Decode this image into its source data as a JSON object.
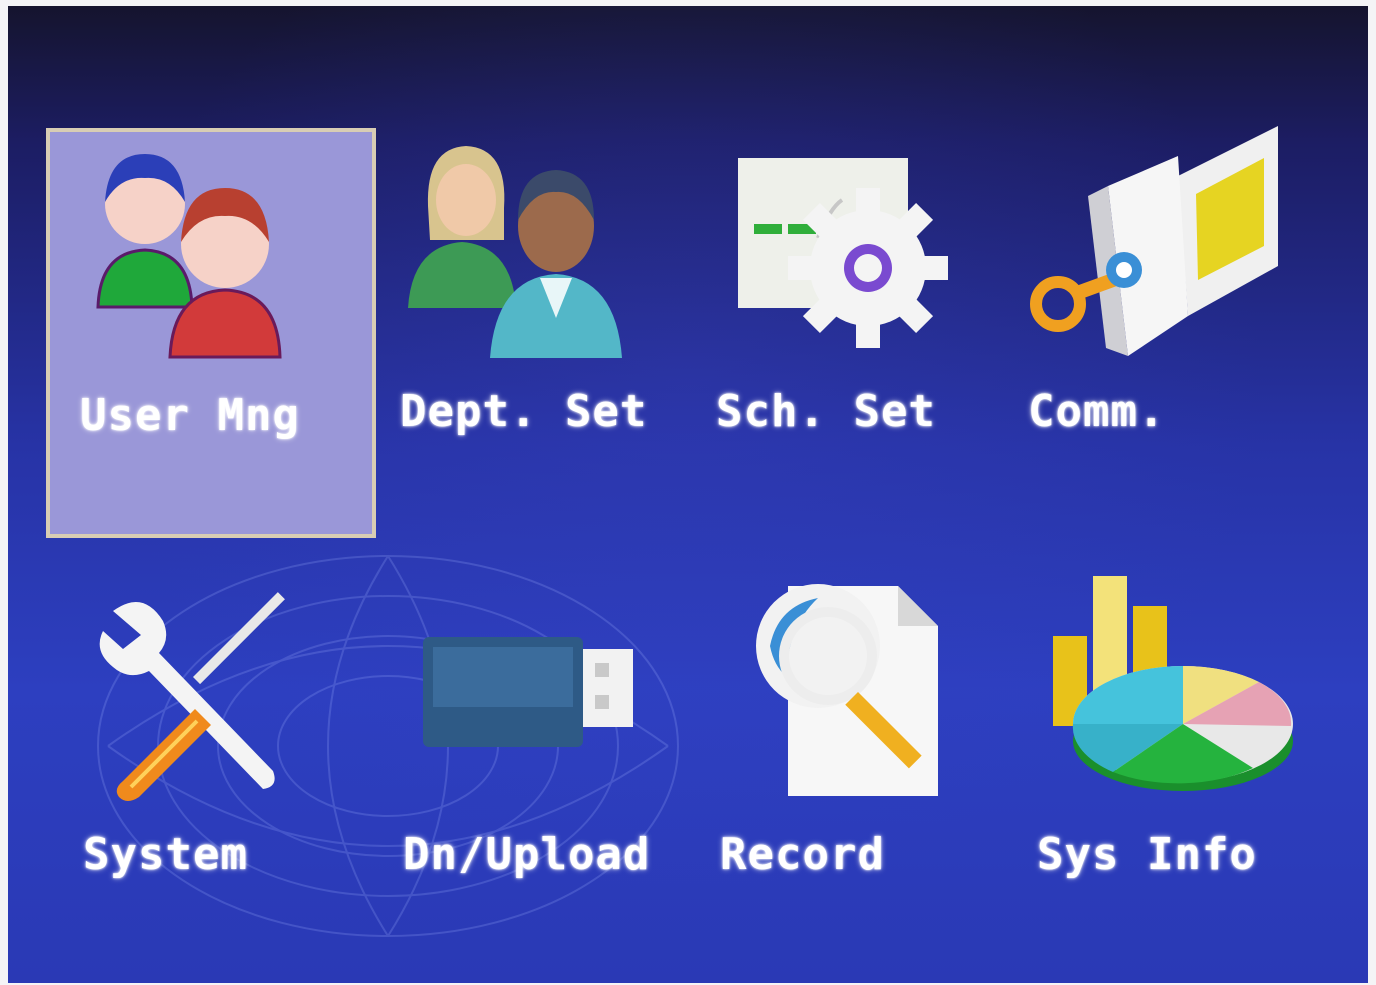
{
  "menu": {
    "items": [
      {
        "label": "User Mng",
        "icon": "users-icon",
        "selected": true
      },
      {
        "label": "Dept. Set",
        "icon": "department-icon",
        "selected": false
      },
      {
        "label": "Sch. Set",
        "icon": "schedule-gear-icon",
        "selected": false
      },
      {
        "label": "Comm.",
        "icon": "network-key-icon",
        "selected": false
      },
      {
        "label": "System",
        "icon": "wrench-screwdriver-icon",
        "selected": false
      },
      {
        "label": "Dn/Upload",
        "icon": "usb-drive-icon",
        "selected": false
      },
      {
        "label": "Record",
        "icon": "record-search-icon",
        "selected": false
      },
      {
        "label": "Sys Info",
        "icon": "chart-pie-icon",
        "selected": false
      }
    ]
  },
  "colors": {
    "selection_fill": "#9a97d8",
    "selection_border": "#d8cdb4",
    "background": "#2733a6"
  }
}
